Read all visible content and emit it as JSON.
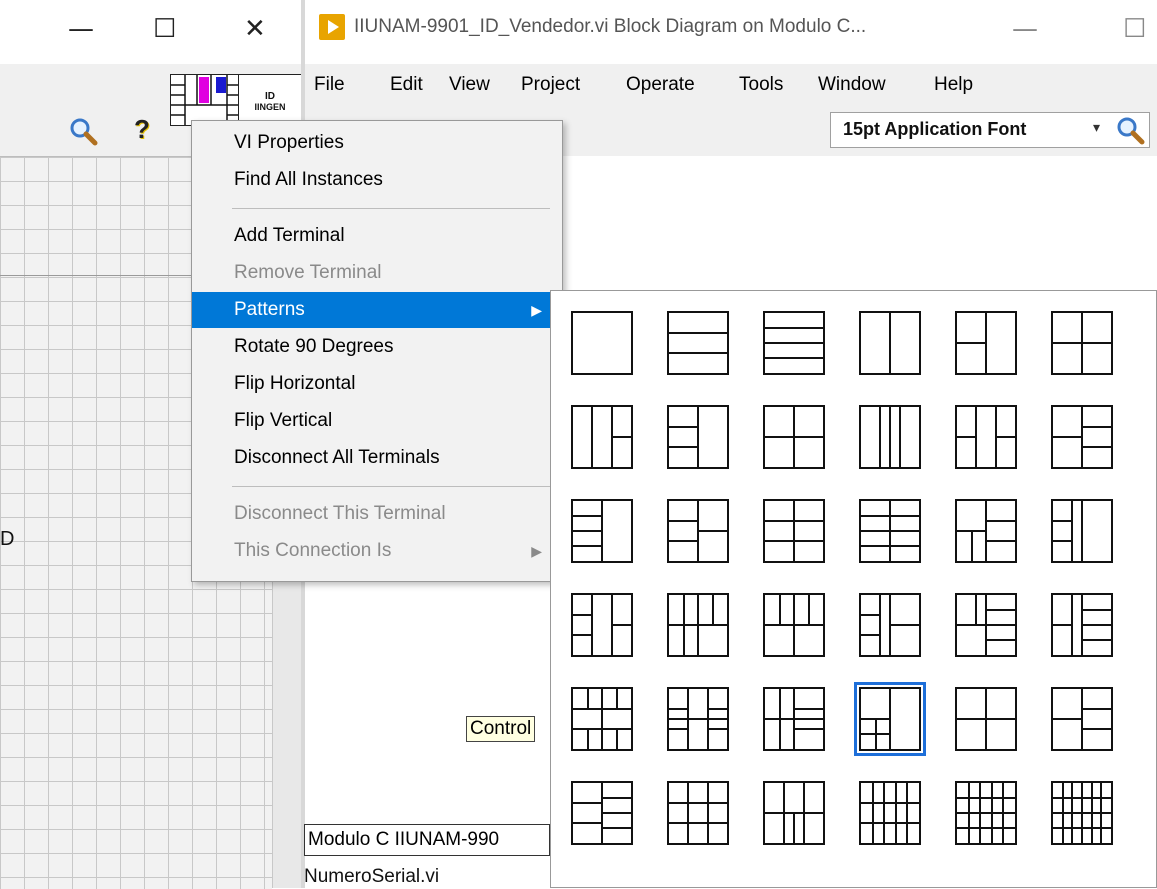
{
  "left_window": {
    "caption_buttons": [
      "—",
      "☐",
      "✕"
    ],
    "toolbar_icons": [
      "search-icon",
      "help-icon"
    ],
    "connector_icon_label": "ID",
    "connector_icon_sub": "IINGEN",
    "partial_glyph": "D"
  },
  "right_window": {
    "title": "IIUNAM-9901_ID_Vendedor.vi Block Diagram on Modulo C...",
    "caption_buttons": [
      "—",
      "☐"
    ],
    "menu": [
      "File",
      "Edit",
      "View",
      "Project",
      "Operate",
      "Tools",
      "Window",
      "Help"
    ],
    "font_ring": "15pt Application Font",
    "labels": {
      "control": "Control",
      "modulo": "Modulo C IIUNAM-990",
      "numero": "NumeroSerial.vi"
    }
  },
  "context_menu": {
    "items": [
      {
        "label": "VI Properties",
        "enabled": true
      },
      {
        "label": "Find All Instances",
        "enabled": true
      },
      {
        "sep": true
      },
      {
        "label": "Add Terminal",
        "enabled": true
      },
      {
        "label": "Remove Terminal",
        "enabled": false
      },
      {
        "label": "Patterns",
        "enabled": true,
        "submenu": true,
        "highlighted": true
      },
      {
        "label": "Rotate 90 Degrees",
        "enabled": true
      },
      {
        "label": "Flip Horizontal",
        "enabled": true
      },
      {
        "label": "Flip Vertical",
        "enabled": true
      },
      {
        "label": "Disconnect All Terminals",
        "enabled": true
      },
      {
        "sep": true
      },
      {
        "label": "Disconnect This Terminal",
        "enabled": false
      },
      {
        "label": "This Connection Is",
        "enabled": false,
        "submenu": true
      }
    ]
  },
  "patterns": {
    "rows": 6,
    "cols": 6,
    "selected_index": 27
  },
  "colors": {
    "highlight": "#0078d7",
    "selection": "#1e6fd9",
    "magenta": "#e000e0",
    "blue": "#1a1ad0"
  }
}
